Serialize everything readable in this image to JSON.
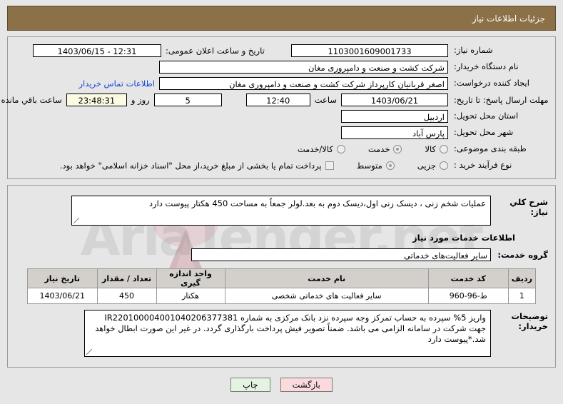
{
  "header": {
    "title": "جزئیات اطلاعات نیاز"
  },
  "form": {
    "need_number": {
      "label": "شماره نیاز:",
      "value": "1103001609001733"
    },
    "announce_datetime": {
      "label": "تاریخ و ساعت اعلان عمومی:",
      "value": "1403/06/15 - 12:31"
    },
    "buyer_org": {
      "label": "نام دستگاه خریدار:",
      "value": "شرکت کشت و صنعت و دامپروری مغان"
    },
    "creator": {
      "label": "ایجاد کننده درخواست:",
      "value": "اصغر قربانیان کارپرداز شرکت کشت و صنعت و دامپروری مغان"
    },
    "contact_link": "اطلاعات تماس خریدار",
    "deadline": {
      "label": "مهلت ارسال پاسخ: تا تاریخ:",
      "date": "1403/06/21",
      "time_label": "ساعت",
      "time": "12:40",
      "days": "5",
      "days_label": "روز و",
      "countdown": "23:48:31",
      "countdown_label": "ساعت باقي مانده"
    },
    "province": {
      "label": "استان محل تحویل:",
      "value": "اردبیل"
    },
    "city": {
      "label": "شهر محل تحویل:",
      "value": "پارس آباد"
    },
    "category": {
      "label": "طبقه بندی موضوعی:",
      "options": [
        {
          "label": "کالا",
          "selected": false
        },
        {
          "label": "خدمت",
          "selected": true
        },
        {
          "label": "کالا/خدمت",
          "selected": false
        }
      ]
    },
    "process_type": {
      "label": "نوع فرآیند خرید :",
      "options": [
        {
          "label": "جزیی",
          "selected": false
        },
        {
          "label": "متوسط",
          "selected": true
        }
      ],
      "checkbox": {
        "label": "پرداخت تمام یا بخشی از مبلغ خرید،از محل \"اسناد خزانه اسلامی\" خواهد بود.",
        "checked": false
      }
    }
  },
  "details": {
    "need_description": {
      "label": "شرح کلي نیاز:",
      "value": "عملیات شخم زنی ، دیسک زنی اول،دیسک دوم به بعد.لولر جمعاً به مساحت 450 هکتار پیوست دارد"
    },
    "services_section_title": "اطلاعات خدمات مورد نیاز",
    "service_group": {
      "label": "گروه خدمت:",
      "value": "سایر فعالیت‌های خدماتی"
    },
    "table": {
      "headers": [
        "ردیف",
        "کد خدمت",
        "نام خدمت",
        "واحد اندازه گیری",
        "تعداد / مقدار",
        "تاریخ نیاز"
      ],
      "rows": [
        [
          "1",
          "ط-96-960",
          "سایر فعالیت های خدماتی شخصی",
          "هکتار",
          "450",
          "1403/06/21"
        ]
      ]
    },
    "buyer_notes": {
      "label": "توضیحات خریدار:",
      "value": "واریز 5% سپرده به حساب تمرکز وجه سپرده نزد بانک مرکزی به شماره IR220100004001040206377381 جهت شرکت در سامانه الزامی می باشد. ضمناً تصویر فیش پرداخت بارگذاری گردد. در غیر این صورت ابطال خواهد شد.*پیوست دارد"
    }
  },
  "buttons": {
    "print": "چاپ",
    "back": "بازگشت"
  },
  "watermark": {
    "text": "AriaTender.net"
  },
  "colors": {
    "header_bg": "#8c7047",
    "page_bg": "#e6e6e6",
    "link": "#1447d6",
    "table_header_bg": "#d3d0cb",
    "print_btn": "#e3f5e1",
    "back_btn": "#fadadd",
    "countdown_bg": "#fbfbe4"
  }
}
